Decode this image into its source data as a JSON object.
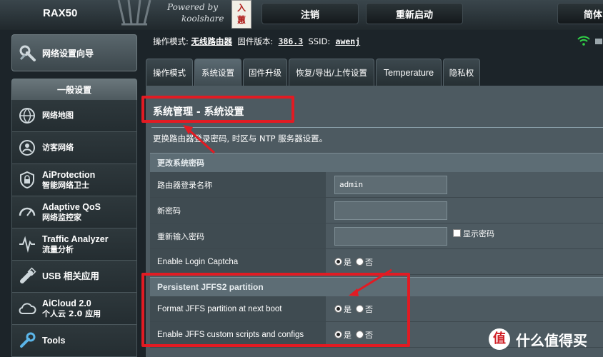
{
  "header": {
    "brand": "RAX50",
    "powered_by_line1": "Powered by",
    "powered_by_line2": "koolshare",
    "seal_text": "入 蕙",
    "logout_label": "注销",
    "reboot_label": "重新启动",
    "language_label": "简体"
  },
  "sidebar": {
    "quick_setup_label": "网络设置向导",
    "general_header": "一般设置",
    "items": [
      {
        "icon": "globe-map-icon",
        "label": "网络地图",
        "sub": ""
      },
      {
        "icon": "guest-network-icon",
        "label": "访客网络",
        "sub": ""
      },
      {
        "icon": "shield-lock-icon",
        "label": "AiProtection",
        "sub": "智能网络卫士"
      },
      {
        "icon": "gauge-icon",
        "label": "Adaptive QoS",
        "sub": "网络监控家"
      },
      {
        "icon": "traffic-pulse-icon",
        "label": "Traffic Analyzer",
        "sub": "流量分析"
      },
      {
        "icon": "usb-icon",
        "label": "USB 相关应用",
        "sub": ""
      },
      {
        "icon": "cloud-icon",
        "label": "AiCloud 2.0",
        "sub": "个人云 2.0 应用"
      },
      {
        "icon": "wrench-icon",
        "label": "Tools",
        "sub": ""
      }
    ]
  },
  "infobar": {
    "mode_label": "操作模式:",
    "mode_value": "无线路由器",
    "firmware_label": "固件版本:",
    "firmware_value": "386.3",
    "ssid_label": "SSID:",
    "ssid_value": "awenj"
  },
  "tabs": [
    {
      "label": "操作模式",
      "active": false
    },
    {
      "label": "系统设置",
      "active": true
    },
    {
      "label": "固件升级",
      "active": false
    },
    {
      "label": "恢复/导出/上传设置",
      "active": false
    },
    {
      "label": "Temperature",
      "active": false
    },
    {
      "label": "隐私权",
      "active": false
    }
  ],
  "main": {
    "title": "系统管理 - 系统设置",
    "description": "更换路由器登录密码, 时区与 NTP 服务器设置。",
    "section_password": {
      "header": "更改系统密码",
      "rows": {
        "login_name_label": "路由器登录名称",
        "login_name_value": "admin",
        "new_password_label": "新密码",
        "new_password_value": "",
        "confirm_password_label": "重新输入密码",
        "confirm_password_value": "",
        "show_password_label": "显示密码",
        "captcha_label": "Enable Login Captcha",
        "captcha_yes": "是",
        "captcha_no": "否"
      }
    },
    "section_jffs": {
      "header": "Persistent JFFS2 partition",
      "format_label": "Format JFFS partition at next boot",
      "format_yes": "是",
      "format_no": "否",
      "scripts_label": "Enable JFFS custom scripts and configs",
      "scripts_yes": "是",
      "scripts_no": "否"
    }
  },
  "watermark": {
    "logo_char": "值",
    "text": "什么值得买"
  },
  "colors": {
    "annotation_red": "#e21b23",
    "panel": "#4d5a61",
    "wifi_green": "#31d047"
  }
}
